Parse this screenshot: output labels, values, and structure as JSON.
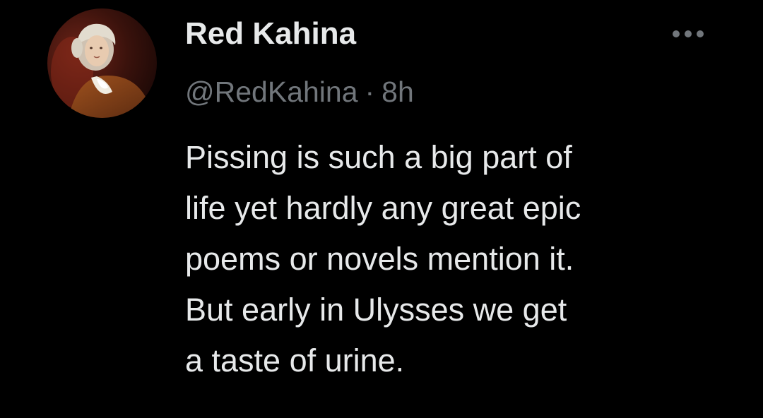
{
  "tweet": {
    "author": {
      "display_name": "Red Kahina",
      "handle": "@RedKahina",
      "avatar": "portrait-avatar"
    },
    "separator": "·",
    "timestamp": "8h",
    "more_icon": "more-horizontal-icon",
    "body_lines": [
      "Pissing is such a big part of",
      "life yet hardly any great epic",
      "poems or novels mention it.",
      "But early in Ulysses we get",
      "a taste of urine."
    ]
  },
  "colors": {
    "background": "#000000",
    "primary_text": "#e7e9ea",
    "secondary_text": "#71767b"
  }
}
